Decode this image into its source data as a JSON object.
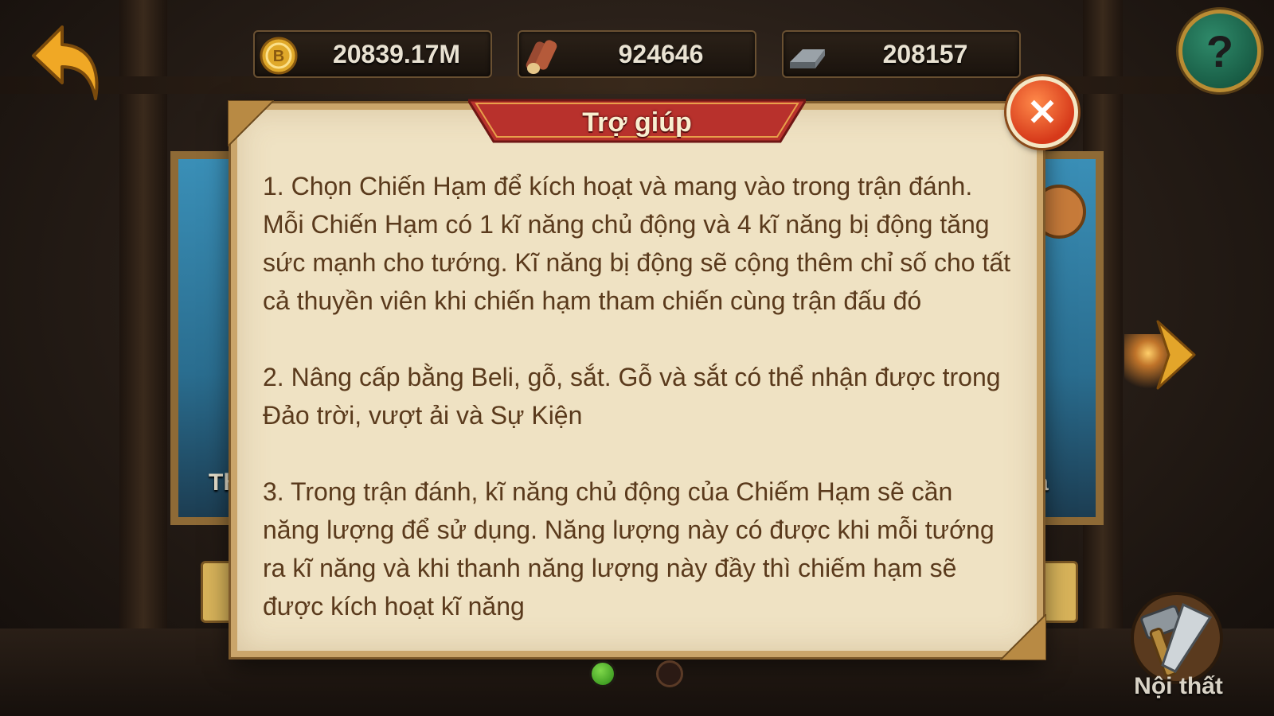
{
  "resources": {
    "beli": {
      "value": "20839.17M",
      "icon": "beli-coin-icon"
    },
    "wood": {
      "value": "924646",
      "icon": "wood-log-icon"
    },
    "iron": {
      "value": "208157",
      "icon": "iron-ingot-icon"
    }
  },
  "dialog": {
    "title": "Trợ giúp",
    "paragraphs": [
      "1. Chọn Chiến Hạm để kích hoạt và mang vào trong trận đánh. Mỗi Chiến Hạm có 1 kĩ năng chủ động và 4 kĩ năng bị động tăng sức mạnh cho tướng. Kĩ năng bị động sẽ cộng thêm chỉ số cho tất cả thuyền viên khi chiến hạm tham chiến cùng trận đấu đó",
      "2. Nâng cấp bằng Beli, gỗ, sắt. Gỗ và sắt có thể nhận được trong Đảo trời, vượt ải và Sự Kiện",
      "3. Trong trận đánh, kĩ năng chủ động của Chiếm Hạm sẽ cần năng lượng để sử dụng. Năng lượng này có được khi mỗi tướng ra kĩ năng và khi thanh năng lượng này đầy thì chiếm hạm sẽ được kích hoạt kĩ năng"
    ],
    "close_glyph": "✕"
  },
  "help_button": {
    "glyph": "?"
  },
  "side_left_label": "Th",
  "side_right_label": "a",
  "furniture_label": "Nội thất",
  "pagination": {
    "current": 1,
    "total": 2
  },
  "colors": {
    "parchment": "#efe2c3",
    "ribbon": "#b8312c",
    "close": "#d6391a",
    "text": "#5a3a1c",
    "active_dot": "#2a8a15"
  }
}
